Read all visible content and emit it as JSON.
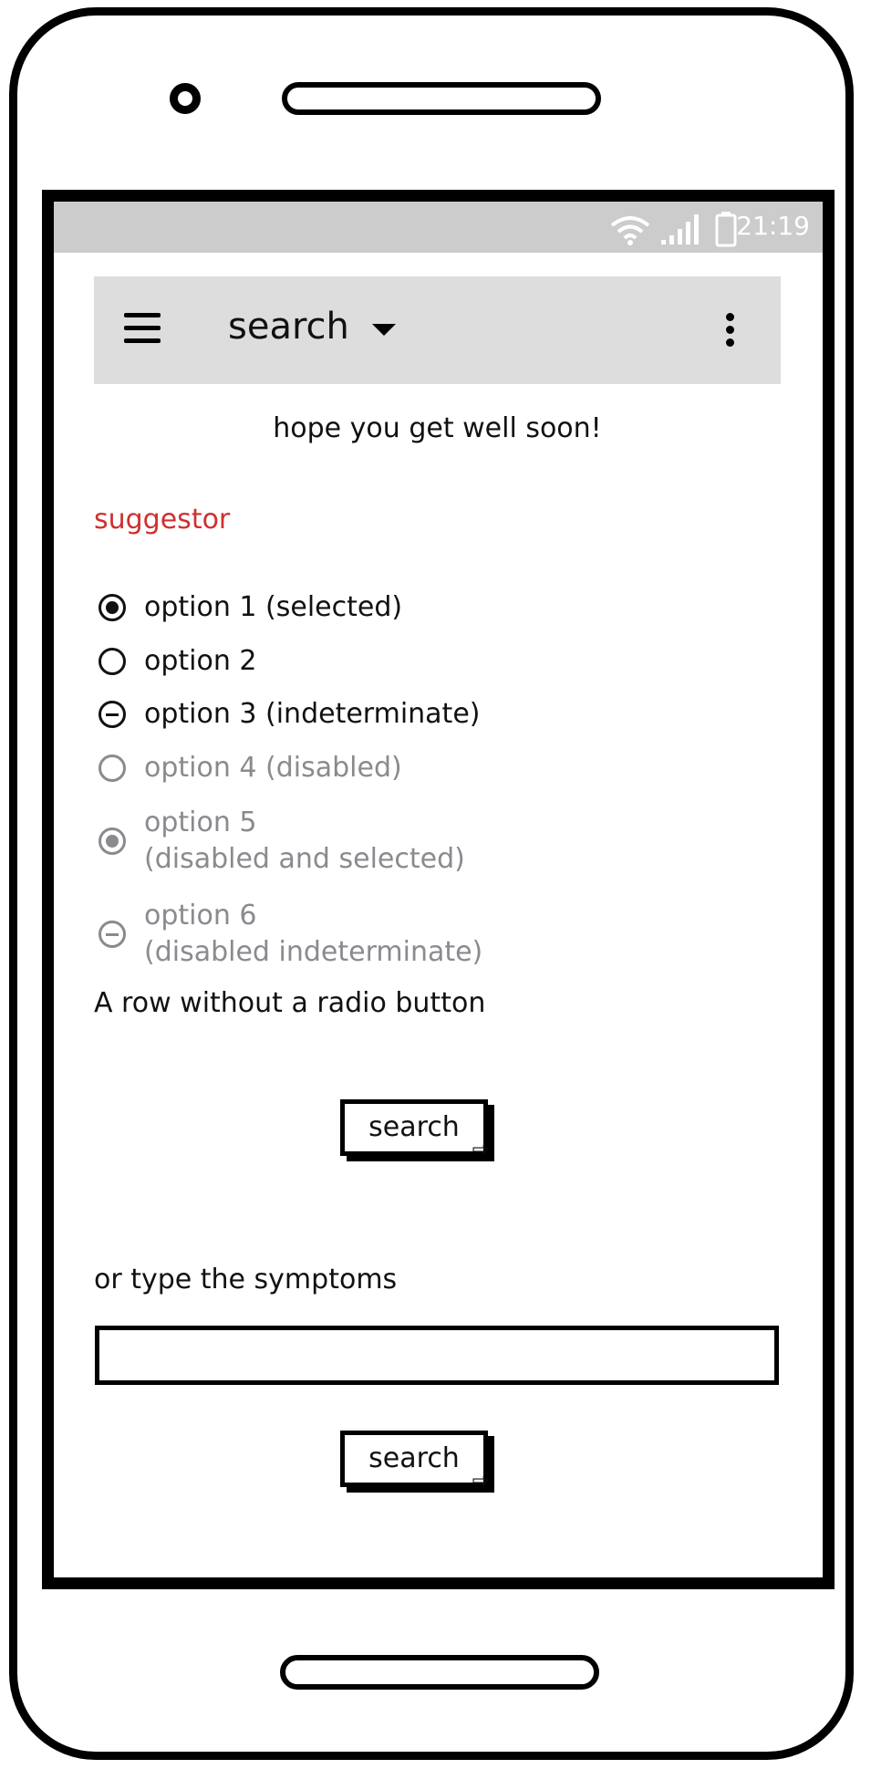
{
  "status_bar": {
    "time": "21:19",
    "icons": [
      "wifi-icon",
      "signal-icon",
      "battery-icon"
    ]
  },
  "app_bar": {
    "title": "search",
    "icons": [
      "menu-icon",
      "chevron-down-icon",
      "overflow-menu-icon"
    ]
  },
  "greeting": "hope you get well soon!",
  "section_heading": "suggestor",
  "options": [
    {
      "line1": "option 1 (selected)",
      "line2": "",
      "state": "selected",
      "disabled": false
    },
    {
      "line1": "option 2",
      "line2": "",
      "state": "unselected",
      "disabled": false
    },
    {
      "line1": "option 3 (indeterminate)",
      "line2": "",
      "state": "indeterminate",
      "disabled": false
    },
    {
      "line1": "option 4 (disabled)",
      "line2": "",
      "state": "unselected",
      "disabled": true
    },
    {
      "line1": "option 5",
      "line2": "(disabled and selected)",
      "state": "selected",
      "disabled": true
    },
    {
      "line1": "option 6",
      "line2": "(disabled indeterminate)",
      "state": "indeterminate",
      "disabled": true
    }
  ],
  "plain_row": "A row without a radio button",
  "buttons": {
    "search_1": "search",
    "search_2": "search"
  },
  "symptoms": {
    "label": "or type the symptoms",
    "value": "",
    "placeholder": ""
  },
  "colors": {
    "heading": "#d02f2f",
    "disabled": "#8a8a8f",
    "status_bar": "#cccccc",
    "app_bar": "#dddddd"
  }
}
